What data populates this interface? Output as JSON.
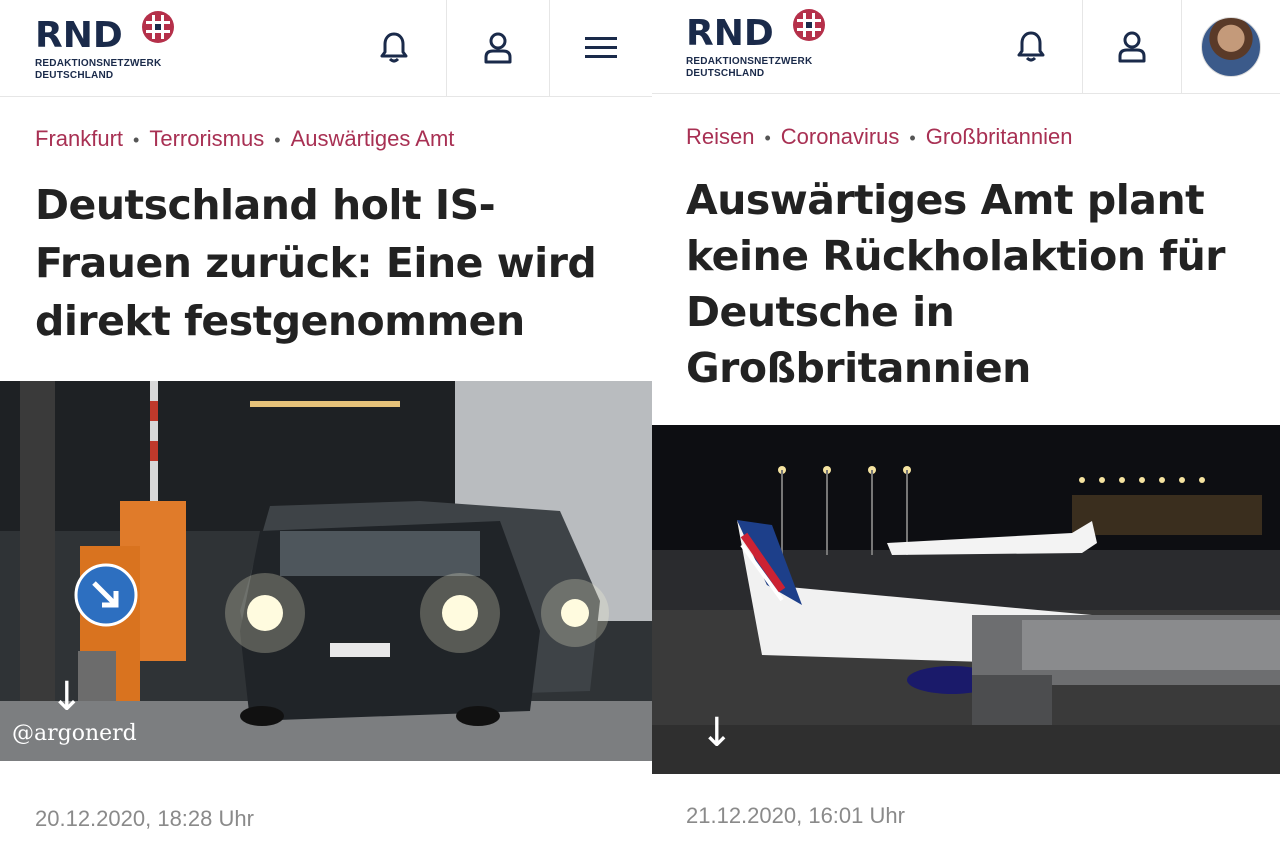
{
  "left": {
    "logo": {
      "word": "RND",
      "subline1": "REDAKTIONSNETZWERK",
      "subline2": "DEUTSCHLAND"
    },
    "icons": [
      "bell-icon",
      "user-icon",
      "menu-icon"
    ],
    "tags": [
      "Frankfurt",
      "Terrorismus",
      "Auswärtiges Amt"
    ],
    "headline": "Deutschland holt IS-Frauen zurück: Eine wird direkt festgenommen",
    "photo_credit": "@argonerd",
    "date": "20.12.2020, 18:28 Uhr"
  },
  "right": {
    "logo": {
      "word": "RND",
      "subline1": "REDAKTIONSNETZWERK",
      "subline2": "DEUTSCHLAND"
    },
    "icons": [
      "bell-icon",
      "user-icon",
      "avatar"
    ],
    "tags": [
      "Reisen",
      "Coronavirus",
      "Großbritannien"
    ],
    "headline": "Auswärtiges Amt plant keine Rückholaktion für Deutsche in Großbritannien",
    "date": "21.12.2020, 16:01 Uhr"
  },
  "colors": {
    "brand_navy": "#1a2a4a",
    "brand_red": "#b5304a",
    "tag_color": "#a83053",
    "headline": "#222222",
    "date": "#8a8a8a"
  }
}
